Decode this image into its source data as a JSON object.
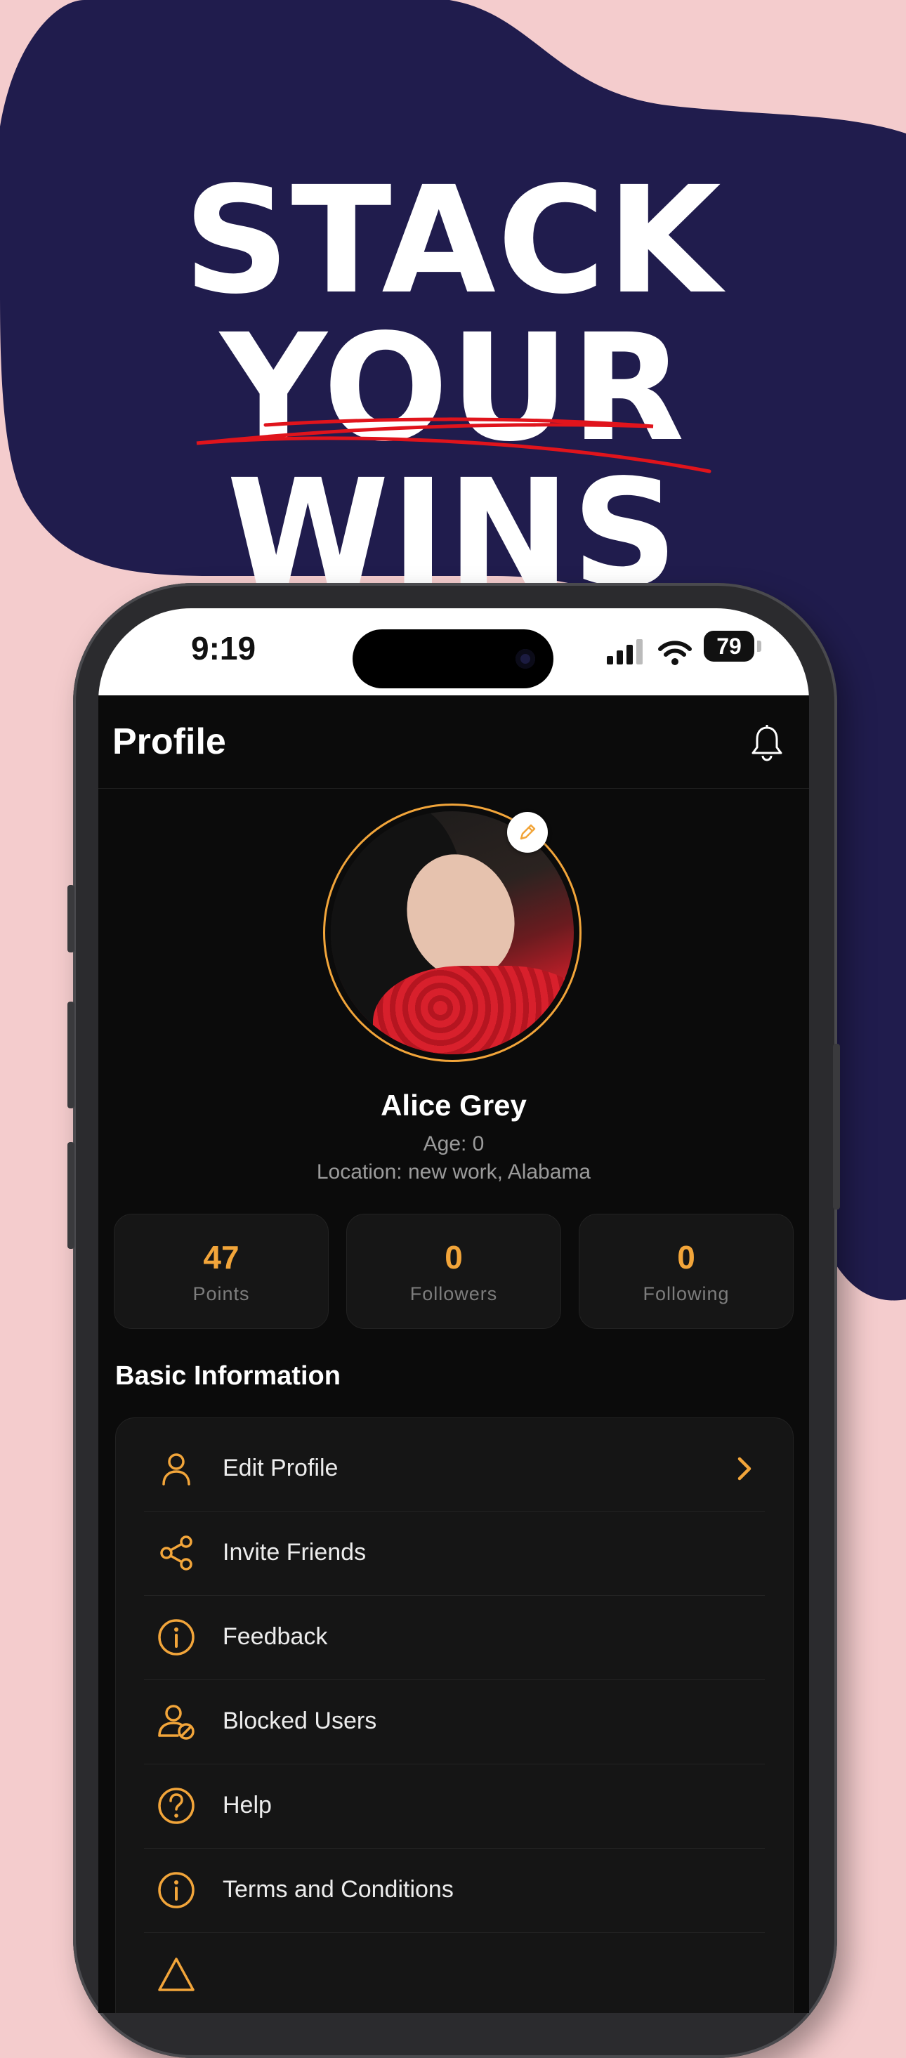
{
  "headline": {
    "line1": "STACK",
    "line2": "YOUR",
    "line3": "WINS"
  },
  "status_bar": {
    "time": "9:19",
    "battery": "79"
  },
  "header": {
    "title": "Profile"
  },
  "profile": {
    "name": "Alice Grey",
    "age": "Age: 0",
    "location": "Location: new work, Alabama"
  },
  "stats": [
    {
      "value": "47",
      "label": "Points"
    },
    {
      "value": "0",
      "label": "Followers"
    },
    {
      "value": "0",
      "label": "Following"
    }
  ],
  "section": {
    "title": "Basic Information"
  },
  "menu": [
    {
      "label": "Edit Profile",
      "icon": "user-icon"
    },
    {
      "label": "Invite Friends",
      "icon": "share-icon"
    },
    {
      "label": "Feedback",
      "icon": "info-icon"
    },
    {
      "label": "Blocked Users",
      "icon": "user-block-icon"
    },
    {
      "label": "Help",
      "icon": "help-icon"
    },
    {
      "label": "Terms and Conditions",
      "icon": "info-icon"
    }
  ],
  "colors": {
    "accent": "#f2a53a",
    "background": "#f4cccd",
    "blob": "#201c4d",
    "screen": "#0b0b0b"
  }
}
